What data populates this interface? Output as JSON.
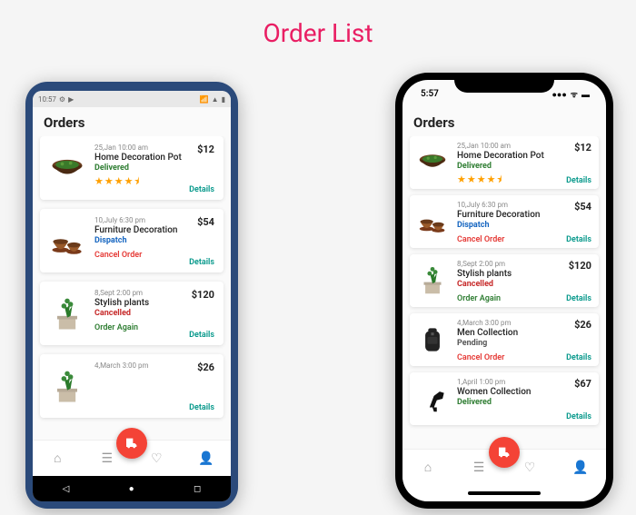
{
  "page_title": "Order List",
  "android": {
    "status_time": "10:57",
    "screen_title": "Orders",
    "details_label": "Details"
  },
  "iphone": {
    "status_time": "5:57",
    "screen_title": "Orders",
    "details_label": "Details"
  },
  "orders_android": [
    {
      "date": "25,Jan 10:00 am",
      "name": "Home Decoration Pot",
      "status": "Delivered",
      "status_class": "st-delivered",
      "price": "$12",
      "rating": 4.5,
      "action": null
    },
    {
      "date": "10,July 6:30 pm",
      "name": "Furniture Decoration",
      "status": "Dispatch",
      "status_class": "st-dispatch",
      "price": "$54",
      "rating": null,
      "action": "Cancel Order",
      "action_class": "act-cancel"
    },
    {
      "date": "8,Sept 2:00 pm",
      "name": "Stylish plants",
      "status": "Cancelled",
      "status_class": "st-cancelled",
      "price": "$120",
      "rating": null,
      "action": "Order Again",
      "action_class": "act-again"
    },
    {
      "date": "4,March 3:00 pm",
      "name": "",
      "status": "",
      "status_class": "",
      "price": "$26",
      "rating": null,
      "action": null
    }
  ],
  "orders_iphone": [
    {
      "date": "25,Jan 10:00 am",
      "name": "Home Decoration Pot",
      "status": "Delivered",
      "status_class": "st-delivered",
      "price": "$12",
      "rating": 4.5,
      "action": null
    },
    {
      "date": "10,July 6:30 pm",
      "name": "Furniture Decoration",
      "status": "Dispatch",
      "status_class": "st-dispatch",
      "price": "$54",
      "rating": null,
      "action": "Cancel Order",
      "action_class": "act-cancel"
    },
    {
      "date": "8,Sept 2:00 pm",
      "name": "Stylish plants",
      "status": "Cancelled",
      "status_class": "st-cancelled",
      "price": "$120",
      "rating": null,
      "action": "Order Again",
      "action_class": "act-again"
    },
    {
      "date": "4,March 3:00 pm",
      "name": "Men Collection",
      "status": "Pending",
      "status_class": "st-pending",
      "price": "$26",
      "rating": null,
      "action": "Cancel Order",
      "action_class": "act-cancel"
    },
    {
      "date": "1,April 1:00 pm",
      "name": "Women Collection",
      "status": "Delivered",
      "status_class": "st-delivered",
      "price": "$67",
      "rating": null,
      "action": null
    }
  ],
  "product_svgs": {
    "pot": "bowl",
    "furniture": "pots",
    "plant": "plant",
    "backpack": "backpack",
    "heel": "heel"
  }
}
